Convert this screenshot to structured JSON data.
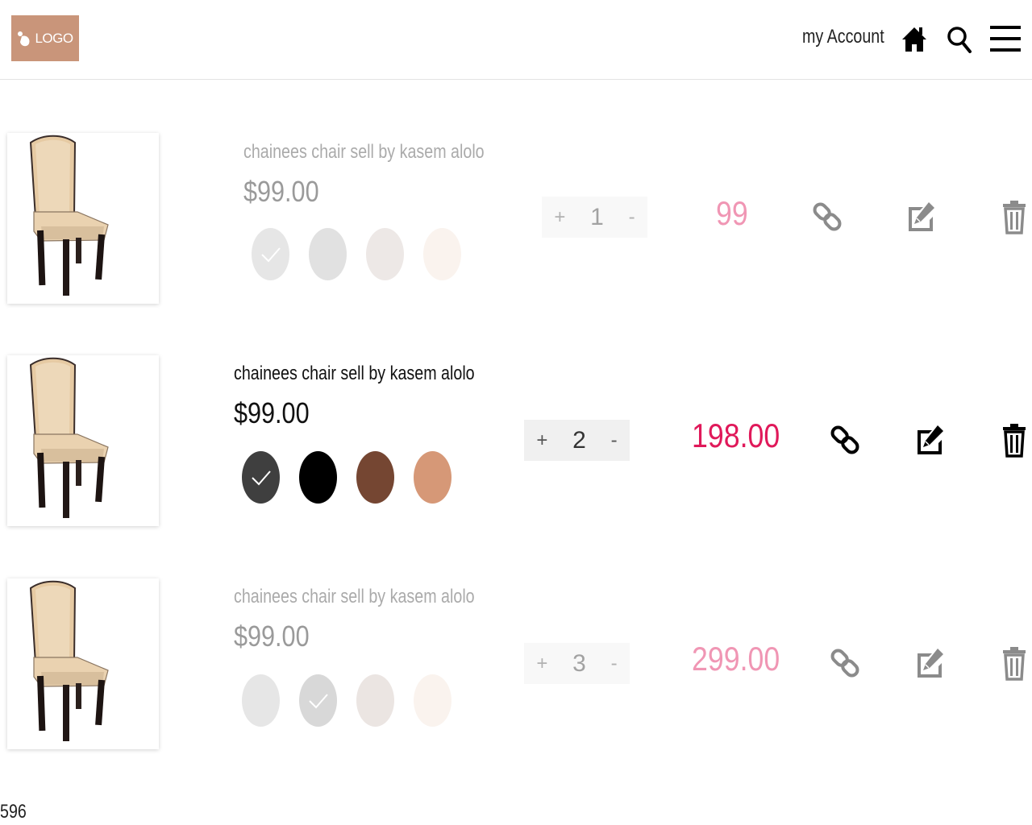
{
  "header": {
    "logo_text": "LOGO",
    "account_label": "my Account",
    "icons": [
      "home-icon",
      "search-icon",
      "menu-icon"
    ],
    "logo_color": "#c9957a"
  },
  "cart": {
    "items": [
      {
        "title": "chainees chair sell by kasem alolo",
        "price": "$99.00",
        "swatches": [
          "#c8c8c8",
          "#bdbdbd",
          "#d9cdc8",
          "#f3e4da"
        ],
        "selected_swatch": 0,
        "quantity": "1",
        "plus": "+",
        "minus": "-",
        "total": "99",
        "state": "faded"
      },
      {
        "title": "chainees chair sell by kasem alolo",
        "price": "$99.00",
        "swatches": [
          "#3f3f3f",
          "#000000",
          "#754632",
          "#d69877"
        ],
        "selected_swatch": 0,
        "quantity": "2",
        "plus": "+",
        "minus": "-",
        "total": "198.00",
        "state": "active"
      },
      {
        "title": "chainees chair sell by kasem alolo",
        "price": "$99.00",
        "swatches": [
          "#c8c8c8",
          "#a9a9a9",
          "#d5c6c0",
          "#f3e4da"
        ],
        "selected_swatch": 1,
        "quantity": "3",
        "plus": "+",
        "minus": "-",
        "total": "299.00",
        "state": "faded"
      }
    ],
    "total_color": "#e0195a",
    "row_icons": [
      "link-icon",
      "edit-icon",
      "trash-icon"
    ]
  },
  "footer": {
    "number": "596"
  }
}
